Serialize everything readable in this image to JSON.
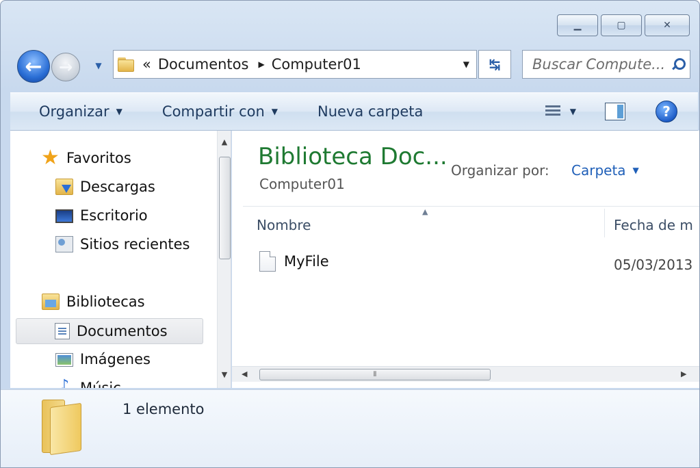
{
  "address": {
    "overflow": "«",
    "crumbs": [
      "Documentos",
      "Computer01"
    ]
  },
  "search": {
    "placeholder": "Buscar Compute..."
  },
  "toolbar": {
    "organize": "Organizar",
    "share": "Compartir con",
    "new_folder": "Nueva carpeta"
  },
  "navpane": {
    "favorites": "Favoritos",
    "downloads": "Descargas",
    "desktop": "Escritorio",
    "recent": "Sitios recientes",
    "libraries": "Bibliotecas",
    "documents": "Documentos",
    "images": "Imágenes",
    "music": "Músic"
  },
  "content": {
    "library_title": "Biblioteca Doc...",
    "library_subtitle": "Computer01",
    "arrange_label": "Organizar por:",
    "arrange_value": "Carpeta",
    "columns": {
      "name": "Nombre",
      "date": "Fecha de m"
    },
    "files": [
      {
        "name": "MyFile",
        "date": "05/03/2013"
      }
    ]
  },
  "status": {
    "count": "1 elemento"
  },
  "colors": {
    "library_title": "#1f7a32",
    "link": "#1f5fb8",
    "chrome": "#d9e6f4"
  }
}
